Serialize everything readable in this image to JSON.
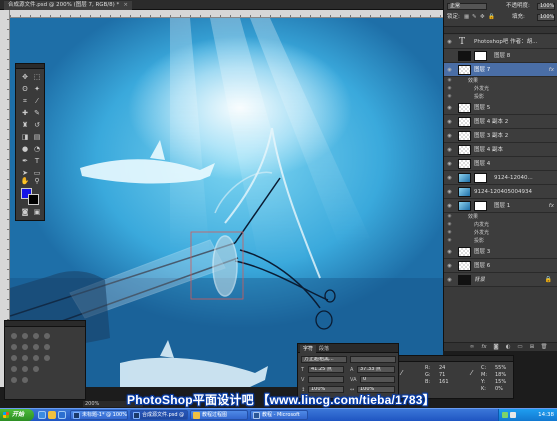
{
  "document": {
    "tab_title": "合成源文件.psd @ 200% (图层 7, RGB/8) *",
    "close_glyph": "×",
    "zoom": "200%"
  },
  "layers_panel": {
    "blend_mode": "正常",
    "opacity_label": "不透明度:",
    "opacity_value": "100%",
    "lock_label": "锁定:",
    "fill_label": "填充:",
    "fill_value": "100%",
    "layers": [
      {
        "name": "Photoshop吧 作者：胡...",
        "type": "text",
        "fx": ""
      },
      {
        "name": "图层 8",
        "type": "mask",
        "fx": ""
      },
      {
        "name": "图层 7",
        "type": "normal",
        "fx": "fx",
        "selected": true,
        "effects_label": "效果",
        "effects": [
          "外发光",
          "投影"
        ]
      },
      {
        "name": "图层 5",
        "type": "normal",
        "fx": ""
      },
      {
        "name": "图层 4 副本 2",
        "type": "normal",
        "fx": ""
      },
      {
        "name": "图层 3 副本 2",
        "type": "normal",
        "fx": ""
      },
      {
        "name": "图层 4 副本",
        "type": "normal",
        "fx": ""
      },
      {
        "name": "图层 4",
        "type": "normal",
        "fx": ""
      },
      {
        "name": "9124-12040...",
        "type": "image-mask",
        "fx": ""
      },
      {
        "name": "9124-120405004934",
        "type": "image",
        "fx": ""
      },
      {
        "name": "图层 1",
        "type": "image-mask",
        "fx": "fx",
        "effects_label": "效果",
        "effects": [
          "内发光",
          "外发光",
          "投影"
        ]
      },
      {
        "name": "图层 3",
        "type": "normal",
        "fx": ""
      },
      {
        "name": "图层 6",
        "type": "normal",
        "fx": ""
      },
      {
        "name": "背景",
        "type": "background",
        "fx": "",
        "locked": true
      }
    ],
    "footer_icons": [
      "link-icon",
      "fx-icon",
      "mask-icon",
      "adjustment-icon",
      "group-icon",
      "new-layer-icon",
      "trash-icon"
    ]
  },
  "character_panel": {
    "tabs": [
      "字符",
      "段落"
    ],
    "font_family": "方正超粗黑...",
    "font_size": "41.25 点",
    "leading": "37.33 点",
    "tracking": "0",
    "scale_v": "100%",
    "scale_h": "100%"
  },
  "info_panel": {
    "r_label": "R:",
    "r": "24",
    "g_label": "G:",
    "g": "71",
    "b_label": "B:",
    "b": "161",
    "c_label": "C:",
    "c": "55%",
    "m_label": "M:",
    "m": "18%",
    "y_label": "Y:",
    "y": "15%",
    "k_label": "K:",
    "k": "0%"
  },
  "status": {
    "zoom_readout": "200%"
  },
  "watermark": {
    "text": "PhotoShop平面设计吧 【www.lincg.com/tieba/1783】 "
  },
  "taskbar": {
    "start_label": "开始",
    "buttons": [
      {
        "label": "未标题-1* @ 100%",
        "icon": "photoshop-icon",
        "active": false
      },
      {
        "label": "合成源文件.psd @",
        "icon": "photoshop-icon",
        "active": true
      },
      {
        "label": "教程过程图",
        "icon": "folder-icon",
        "active": false
      },
      {
        "label": "教程 - Microsoft",
        "icon": "word-icon",
        "active": false
      }
    ],
    "time": "14:38"
  },
  "colors": {
    "foreground": "#1414e6",
    "background": "#000000",
    "selection": "#4a6ea6",
    "panel": "#3a3a3a"
  }
}
